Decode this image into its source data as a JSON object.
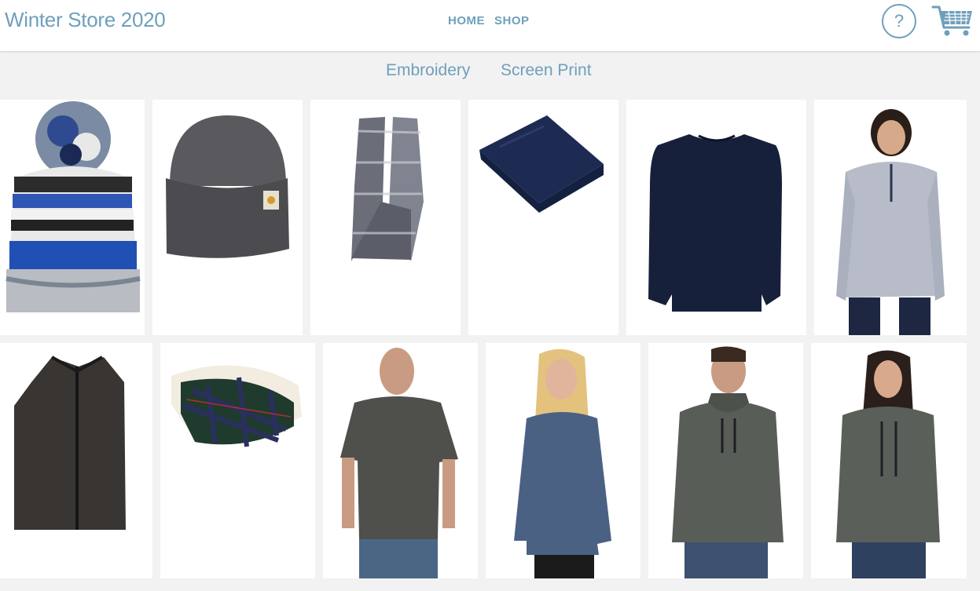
{
  "header": {
    "brand": "Winter Store 2020",
    "nav": [
      {
        "label": "HOME"
      },
      {
        "label": "SHOP"
      }
    ],
    "help_label": "?",
    "help_icon": "help-icon",
    "cart_icon": "shopping-cart-icon"
  },
  "subnav": {
    "items": [
      {
        "label": "Embroidery"
      },
      {
        "label": "Screen Print"
      }
    ]
  },
  "colors": {
    "accent": "#6f9fbb",
    "background": "#f2f2f2",
    "card": "#ffffff"
  },
  "products": [
    {
      "icon": "pom-beanie-icon"
    },
    {
      "icon": "cuffed-beanie-icon"
    },
    {
      "icon": "knit-scarf-icon"
    },
    {
      "icon": "fleece-blanket-icon"
    },
    {
      "icon": "long-sleeve-thermal-icon"
    },
    {
      "icon": "sherpa-pullover-icon"
    },
    {
      "icon": "sweater-vest-icon"
    },
    {
      "icon": "plaid-sherpa-blanket-icon"
    },
    {
      "icon": "mens-tee-icon"
    },
    {
      "icon": "womens-long-sleeve-icon"
    },
    {
      "icon": "mens-hoodie-icon"
    },
    {
      "icon": "womens-hoodie-icon"
    }
  ]
}
